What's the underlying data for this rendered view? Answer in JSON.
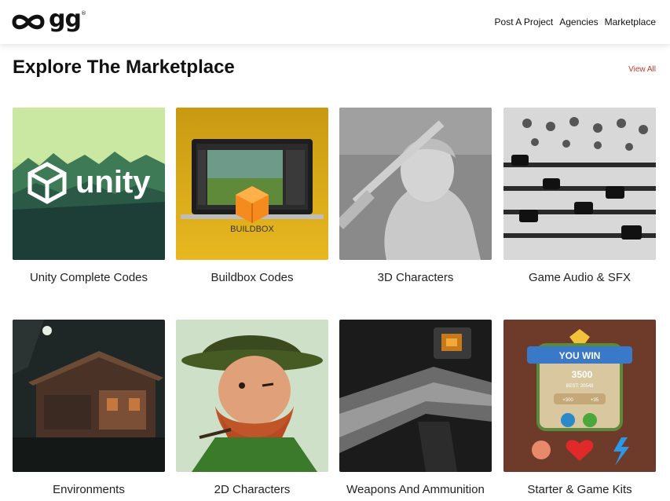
{
  "header": {
    "logo_text": "gg",
    "logo_mark": "®",
    "nav": [
      "Post A Project",
      "Agencies",
      "Marketplace"
    ]
  },
  "main": {
    "title": "Explore The Marketplace",
    "view_all": "View All",
    "cards": [
      {
        "label": "Unity Complete Codes",
        "overlay": "unity"
      },
      {
        "label": "Buildbox Codes",
        "overlay": "BUILDBOX"
      },
      {
        "label": "3D Characters"
      },
      {
        "label": "Game Audio & SFX"
      },
      {
        "label": "Environments"
      },
      {
        "label": "2D Characters"
      },
      {
        "label": "Weapons And Ammunition"
      },
      {
        "label": "Starter & Game Kits",
        "overlay_title": "YOU WIN",
        "overlay_score": "3500",
        "overlay_best": "BEST: 20548",
        "overlay_coins": "+300",
        "overlay_gems": "+35"
      }
    ]
  },
  "colors": {
    "accent": "#c0392b",
    "text": "#111111"
  }
}
